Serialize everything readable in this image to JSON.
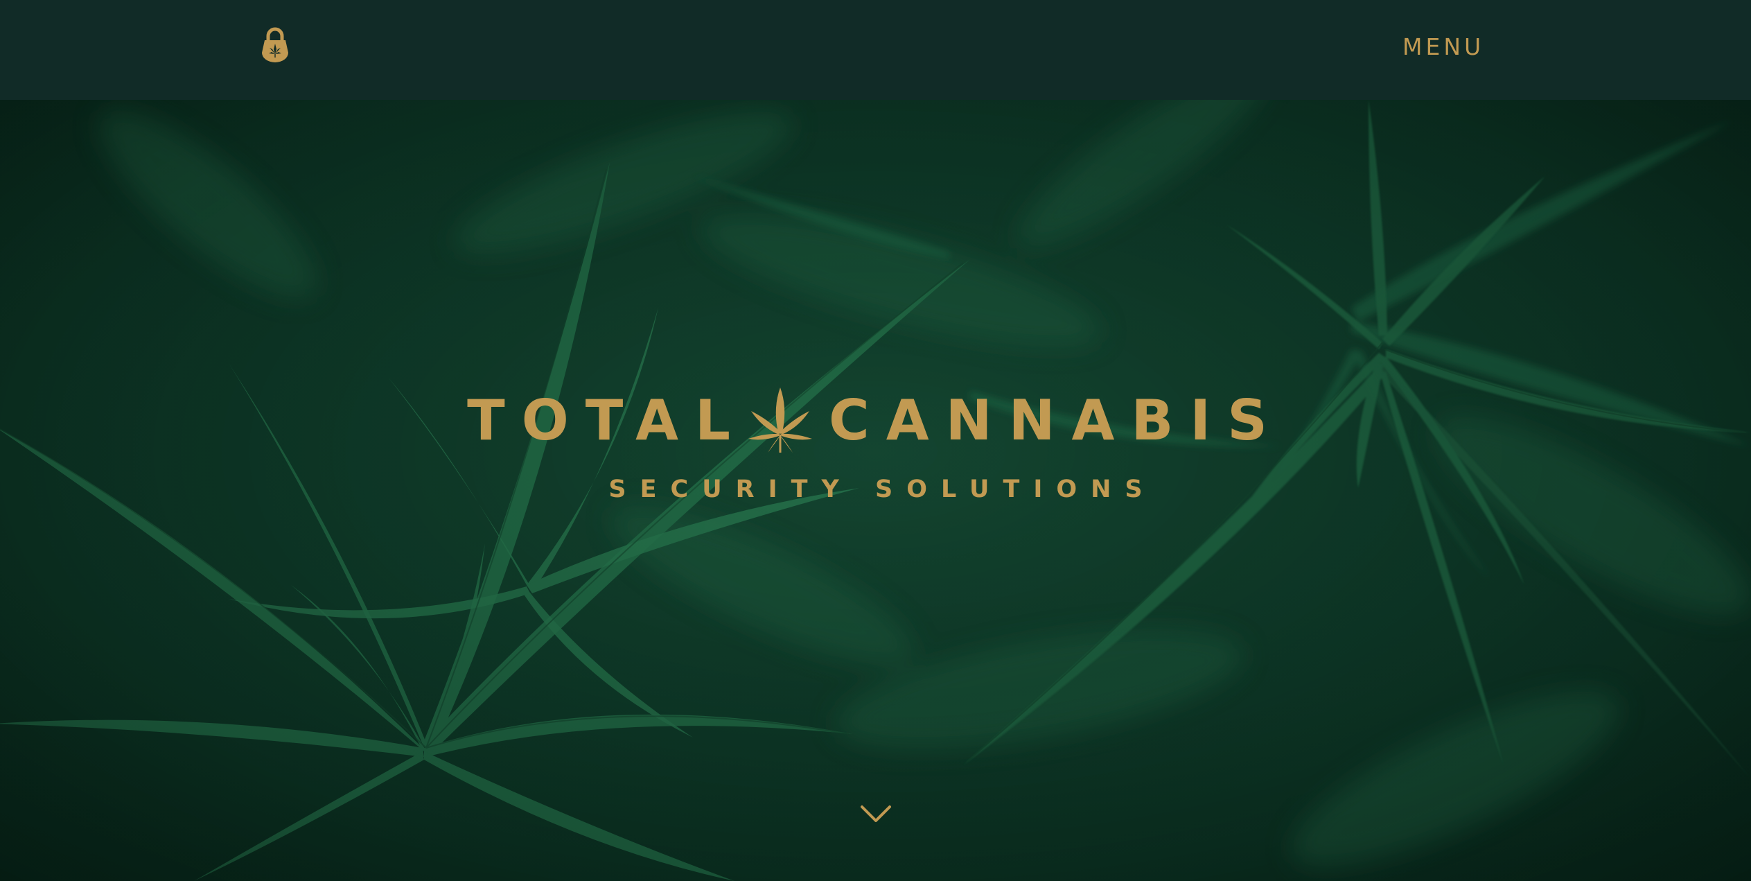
{
  "header": {
    "logo_icon": "lock-leaf-icon",
    "menu_label": "MENU"
  },
  "hero": {
    "background": "cannabis-plants-photo",
    "title_left": "TOTAL",
    "title_icon": "cannabis-leaf-icon",
    "title_right": "CANNABIS",
    "subtitle": "SECURITY SOLUTIONS",
    "scroll_icon": "chevron-down-icon"
  },
  "colors": {
    "header_bg": "#112b27",
    "accent_gold": "#c29a52",
    "hero_green": "#0e3324"
  }
}
